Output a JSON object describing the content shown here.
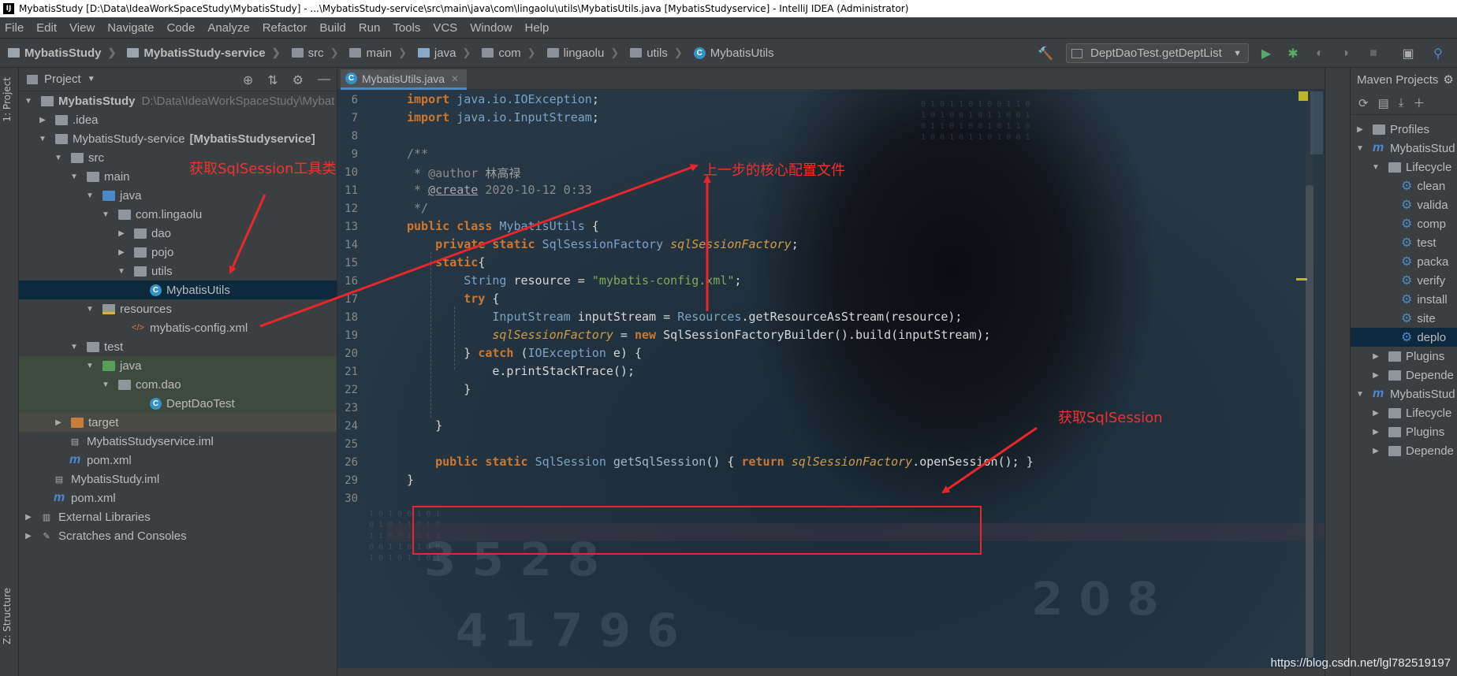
{
  "window": {
    "title": "MybatisStudy [D:\\Data\\IdeaWorkSpaceStudy\\MybatisStudy] - ...\\MybatisStudy-service\\src\\main\\java\\com\\lingaolu\\utils\\MybatisUtils.java [MybatisStudyservice] - IntelliJ IDEA (Administrator)",
    "app_icon": "IJ"
  },
  "menu": [
    "File",
    "Edit",
    "View",
    "Navigate",
    "Code",
    "Analyze",
    "Refactor",
    "Build",
    "Run",
    "Tools",
    "VCS",
    "Window",
    "Help"
  ],
  "breadcrumbs": [
    "MybatisStudy",
    "MybatisStudy-service",
    "src",
    "main",
    "java",
    "com",
    "lingaolu",
    "utils",
    "MybatisUtils"
  ],
  "toolbar": {
    "run_config": "DeptDaoTest.getDeptList",
    "build_icon": "hammer-icon",
    "run_icon": "run-icon",
    "debug_icon": "debug-icon"
  },
  "left_strip": {
    "project_tab": "1: Project",
    "structure_tab": "Z: Structure"
  },
  "project_panel": {
    "title": "Project",
    "tree": [
      {
        "label": "MybatisStudy",
        "extra": "D:\\Data\\IdeaWorkSpaceStudy\\Mybat"
      },
      {
        "label": ".idea"
      },
      {
        "label": "MybatisStudy-service",
        "extra": "[MybatisStudyservice]"
      },
      {
        "label": "src"
      },
      {
        "label": "main"
      },
      {
        "label": "java"
      },
      {
        "label": "com.lingaolu"
      },
      {
        "label": "dao"
      },
      {
        "label": "pojo"
      },
      {
        "label": "utils"
      },
      {
        "label": "MybatisUtils"
      },
      {
        "label": "resources"
      },
      {
        "label": "mybatis-config.xml"
      },
      {
        "label": "test"
      },
      {
        "label": "java"
      },
      {
        "label": "com.dao"
      },
      {
        "label": "DeptDaoTest"
      },
      {
        "label": "target"
      },
      {
        "label": "MybatisStudyservice.iml"
      },
      {
        "label": "pom.xml"
      },
      {
        "label": "MybatisStudy.iml"
      },
      {
        "label": "pom.xml"
      },
      {
        "label": "External Libraries"
      },
      {
        "label": "Scratches and Consoles"
      }
    ]
  },
  "editor": {
    "tab_label": "MybatisUtils.java",
    "line_numbers": [
      "6",
      "7",
      "8",
      "9",
      "10",
      "11",
      "12",
      "13",
      "14",
      "15",
      "16",
      "17",
      "18",
      "19",
      "20",
      "21",
      "22",
      "23",
      "24",
      "25",
      "26",
      "29",
      "30"
    ],
    "code": {
      "l6_kw": "import ",
      "l6_a": "java.io.",
      "l6_b": "IOException",
      "l6_c": ";",
      "l7_kw": "import ",
      "l7_a": "java.io.",
      "l7_b": "InputStream",
      "l7_c": ";",
      "l9": "/**",
      "l10_a": " * @author ",
      "l10_b": "林高禄",
      "l11_a": " * ",
      "l11_b": "@create",
      "l11_c": " 2020-10-12 0:33",
      "l12": " */",
      "l13_kw": "public class ",
      "l13_cls": "MybatisUtils",
      "l13_c": " {",
      "l14_kw": "    private static ",
      "l14_cls": "SqlSessionFactory ",
      "l14_fld": "sqlSessionFactory",
      "l14_c": ";",
      "l15_kw": "    static",
      "l15_c": "{",
      "l16_cls": "        String ",
      "l16_a": "resource = ",
      "l16_str": "\"mybatis-config.xml\"",
      "l16_c": ";",
      "l17_kw": "        try ",
      "l17_c": "{",
      "l18_cls": "            InputStream ",
      "l18_a": "inputStream = ",
      "l18_cls2": "Resources",
      "l18_b": ".getResourceAsStream(resource);",
      "l19_fld": "            sqlSessionFactory",
      "l19_a": " = ",
      "l19_kw": "new ",
      "l19_b": "SqlSessionFactoryBuilder().build(inputStream);",
      "l20_a": "        } ",
      "l20_kw": "catch ",
      "l20_b": "(",
      "l20_cls": "IOException",
      "l20_c": " e) {",
      "l21": "            e.printStackTrace();",
      "l22": "        }",
      "l24": "    }",
      "l26_kw": "    public static ",
      "l26_cls": "SqlSession ",
      "l26_m": "getSqlSession",
      "l26_a": "() { ",
      "l26_kw2": "return ",
      "l26_fld": "sqlSessionFactory",
      "l26_b": ".openSession(); }",
      "l29": "}"
    }
  },
  "annotations": {
    "a1": "获取SqlSession工具类",
    "a2": "上一步的核心配置文件",
    "a3": "获取SqlSession"
  },
  "maven_panel": {
    "title": "Maven Projects",
    "rows": [
      "Profiles",
      "MybatisStud",
      "Lifecycle",
      "clean",
      "valida",
      "comp",
      "test",
      "packa",
      "verify",
      "install",
      "site",
      "deplo",
      "Plugins",
      "Depende",
      "MybatisStud",
      "Lifecycle",
      "Plugins",
      "Depende"
    ]
  },
  "watermark": "https://blog.csdn.net/lgl782519197",
  "colors": {
    "accent": "#4a88c7",
    "annotation_red": "#e8262e",
    "keyword": "#cc7832",
    "string": "#7faa5c"
  }
}
